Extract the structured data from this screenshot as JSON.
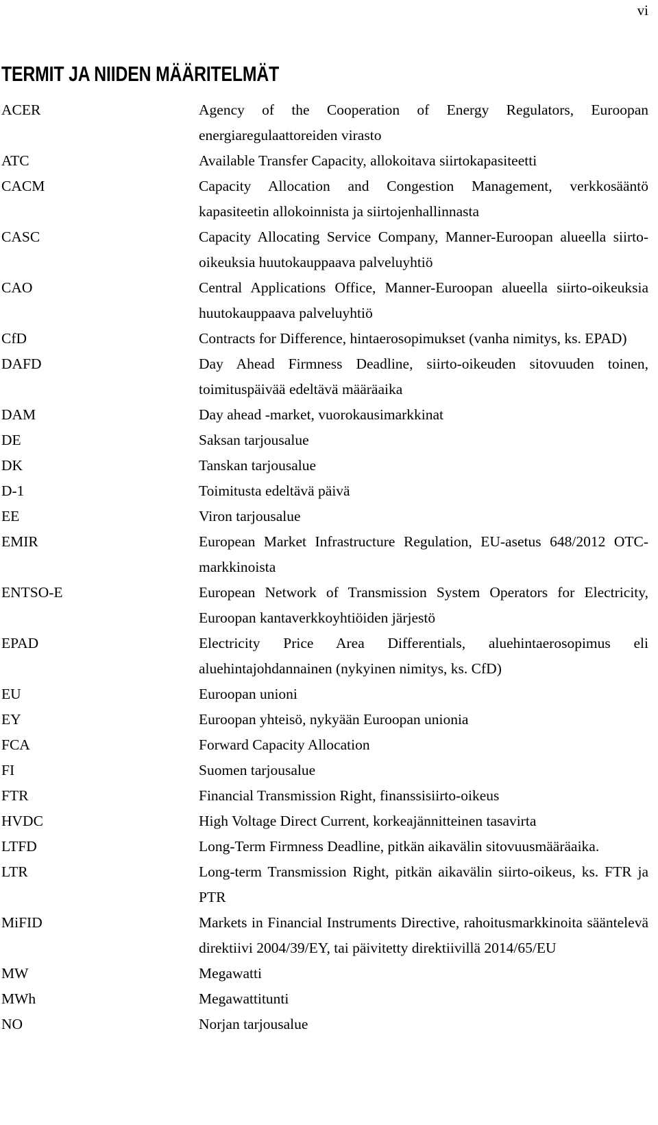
{
  "page": {
    "page_number": "vi",
    "title": "TERMIT JA NIIDEN MÄÄRITELMÄT"
  },
  "glossary": {
    "entries": [
      {
        "term": "ACER",
        "definition": "Agency of the Cooperation of Energy Regulators, Euroopan energiaregulaattoreiden virasto"
      },
      {
        "term": "ATC",
        "definition": "Available Transfer Capacity, allokoitava siirtokapasiteetti"
      },
      {
        "term": "CACM",
        "definition": "Capacity Allocation and Congestion Management, verkkosääntö kapasiteetin allokoinnista ja siirtojenhallinnasta"
      },
      {
        "term": "CASC",
        "definition": "Capacity Allocating Service Company, Manner-Euroopan alueella siirto-oikeuksia huutokauppaava palveluyhtiö"
      },
      {
        "term": "CAO",
        "definition": "Central Applications Office, Manner-Euroopan alueella siirto-oikeuksia huutokauppaava palveluyhtiö"
      },
      {
        "term": "CfD",
        "definition": "Contracts for Difference, hintaerosopimukset (vanha nimitys, ks. EPAD)"
      },
      {
        "term": "DAFD",
        "definition": "Day Ahead Firmness Deadline, siirto-oikeuden sitovuuden toinen, toimituspäivää edeltävä määräaika"
      },
      {
        "term": "DAM",
        "definition": "Day ahead -market, vuorokausimarkkinat"
      },
      {
        "term": "DE",
        "definition": "Saksan tarjousalue"
      },
      {
        "term": "DK",
        "definition": "Tanskan tarjousalue"
      },
      {
        "term": "D-1",
        "definition": "Toimitusta edeltävä päivä"
      },
      {
        "term": "EE",
        "definition": "Viron tarjousalue"
      },
      {
        "term": "EMIR",
        "definition": "European Market Infrastructure Regulation, EU-asetus 648/2012 OTC-markkinoista"
      },
      {
        "term": "ENTSO-E",
        "definition": "European Network of Transmission System Operators for Electricity, Euroopan kantaverkkoyhtiöiden järjestö"
      },
      {
        "term": "EPAD",
        "definition": "Electricity Price Area Differentials, aluehintaerosopimus eli aluehintajohdannainen (nykyinen nimitys, ks. CfD)"
      },
      {
        "term": "EU",
        "definition": "Euroopan unioni"
      },
      {
        "term": "EY",
        "definition": "Euroopan yhteisö, nykyään Euroopan unionia"
      },
      {
        "term": "FCA",
        "definition": "Forward Capacity Allocation"
      },
      {
        "term": "FI",
        "definition": "Suomen tarjousalue"
      },
      {
        "term": "FTR",
        "definition": "Financial Transmission Right, finanssisiirto-oikeus"
      },
      {
        "term": "HVDC",
        "definition": "High Voltage Direct Current, korkeajännitteinen tasavirta"
      },
      {
        "term": "LTFD",
        "definition": "Long-Term Firmness Deadline, pitkän aikavälin sitovuusmääräaika."
      },
      {
        "term": "LTR",
        "definition": "Long-term Transmission Right, pitkän aikavälin siirto-oikeus, ks. FTR ja PTR"
      },
      {
        "term": "MiFID",
        "definition": "Markets in Financial Instruments Directive, rahoitusmarkkinoita sääntelevä direktiivi 2004/39/EY, tai päivitetty direktiivillä 2014/65/EU"
      },
      {
        "term": "MW",
        "definition": "Megawatti"
      },
      {
        "term": "MWh",
        "definition": "Megawattitunti"
      },
      {
        "term": "NO",
        "definition": "Norjan tarjousalue"
      }
    ]
  }
}
